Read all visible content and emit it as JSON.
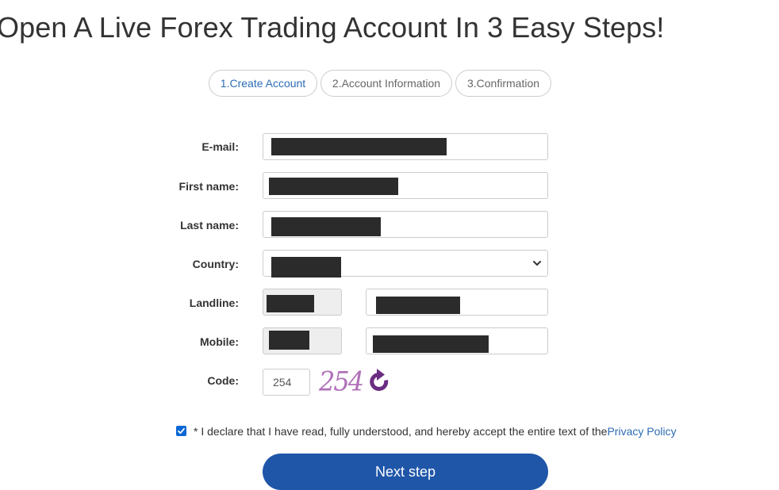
{
  "page": {
    "title": "Open A Live Forex Trading Account In 3 Easy Steps!"
  },
  "steps": [
    {
      "label": "1.Create Account",
      "active": true
    },
    {
      "label": "2.Account Information",
      "active": false
    },
    {
      "label": "3.Confirmation",
      "active": false
    }
  ],
  "form": {
    "email_label": "E-mail:",
    "first_name_label": "First name:",
    "last_name_label": "Last name:",
    "country_label": "Country:",
    "landline_label": "Landline:",
    "mobile_label": "Mobile:",
    "code_label": "Code:",
    "code_value": "254",
    "captcha_text": "254"
  },
  "declaration": {
    "text": "* I declare that I have read, fully understood, and hereby accept the entire text of the ",
    "link": "Privacy Policy",
    "checked": true
  },
  "buttons": {
    "next_label": "Next step"
  },
  "colors": {
    "accent": "#1f56a8",
    "link": "#2d6db5",
    "captcha": "#b070b8",
    "refresh_icon": "#6b2d82"
  },
  "icons": {
    "select": "chevron-down-icon",
    "refresh": "refresh-icon",
    "checkbox": "checkmark-icon"
  }
}
